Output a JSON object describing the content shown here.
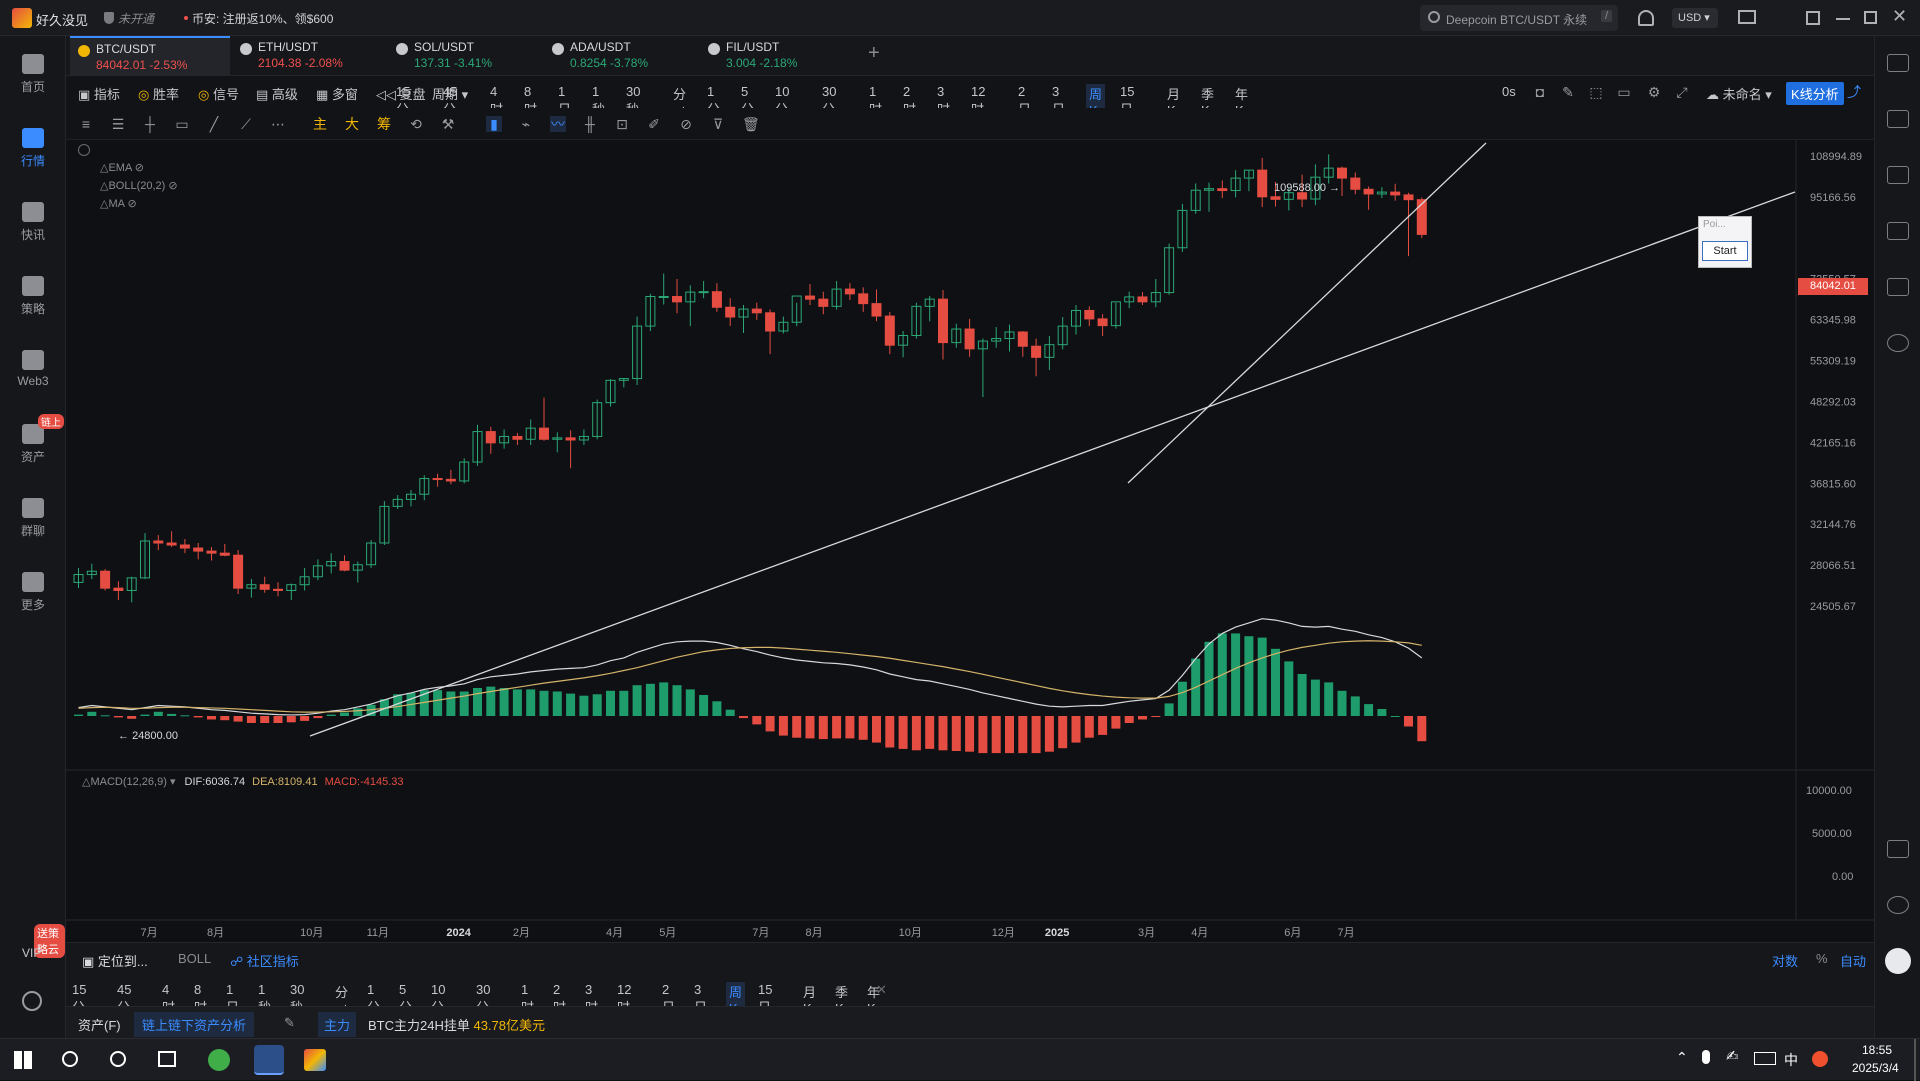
{
  "app": {
    "name": "好久没见",
    "status_badge": "未开通",
    "promo": "币安: 注册返10%、领$600",
    "search_placeholder": "Deepcoin BTC/USDT 永续",
    "search_shortcut": "/",
    "currency": "USD"
  },
  "leftnav": [
    {
      "label": "首页"
    },
    {
      "label": "行情"
    },
    {
      "label": "快讯"
    },
    {
      "label": "策略"
    },
    {
      "label": "Web3"
    },
    {
      "label": "资产",
      "badge": "链上"
    },
    {
      "label": "群聊"
    },
    {
      "label": "更多"
    }
  ],
  "leftnav_bottom": {
    "vip": "VIP",
    "vip_badge": "送策略云"
  },
  "tabs": [
    {
      "symbol": "BTC/USDT",
      "price": "84042.01",
      "change": "-2.53%",
      "color": "#f2b705"
    },
    {
      "symbol": "ETH/USDT",
      "price": "2104.38",
      "change": "-2.08%",
      "color": "#c8c9cc"
    },
    {
      "symbol": "SOL/USDT",
      "price": "137.31",
      "change": "-3.41%",
      "color": "#c8c9cc"
    },
    {
      "symbol": "ADA/USDT",
      "price": "0.8254",
      "change": "-3.78%",
      "color": "#c8c9cc"
    },
    {
      "symbol": "FIL/USDT",
      "price": "3.004",
      "change": "-2.18%",
      "color": "#c8c9cc"
    }
  ],
  "toolbar": {
    "indicators": "指标",
    "winrate": "胜率",
    "signal": "信号",
    "advanced": "高级",
    "multiwin": "多窗",
    "replay": "复盘",
    "period": "周期",
    "timeframes": [
      "15分",
      "45分",
      "4时",
      "8时",
      "1日",
      "1秒",
      "30秒",
      "分时",
      "1分",
      "5分",
      "10分",
      "30分",
      "1时",
      "2时",
      "3时",
      "12时",
      "2日",
      "3日",
      "周K",
      "15日",
      "月K",
      "季K",
      "年K"
    ],
    "selected_tf": "周K",
    "right_label_0s": "0s",
    "unnamed": "未命名",
    "kline_analysis": "K线分析"
  },
  "drawtools": {
    "main": "主",
    "big": "大",
    "chip": "筹"
  },
  "chart_overlays": {
    "legend": [
      {
        "name": "EMA"
      },
      {
        "name": "BOLL(20,2)"
      },
      {
        "name": "MA"
      }
    ],
    "high_label": "109588.00",
    "low_label": "24800.00",
    "current_price": "84042.01",
    "popup_title": "Poi...",
    "popup_button": "Start"
  },
  "macd": {
    "label": "MACD(12,26,9)",
    "dif": "DIF:6036.74",
    "dea": "DEA:8109.41",
    "macd": "MACD:-4145.33",
    "yticks": [
      "10000.00",
      "5000.00",
      "0.00"
    ]
  },
  "chart_data": {
    "type": "candlestick",
    "yaxis_ticks": [
      "108994.89",
      "95166.56",
      "72550.57",
      "63345.98",
      "55309.19",
      "48292.03",
      "42165.16",
      "36815.60",
      "32144.76",
      "28066.51",
      "24505.67"
    ],
    "xaxis_ticks": [
      "7月",
      "8月",
      "10月",
      "11月",
      "2024",
      "2月",
      "4月",
      "5月",
      "7月",
      "8月",
      "10月",
      "12月",
      "2025",
      "3月",
      "4月",
      "6月",
      "7月"
    ],
    "ohlc": [
      [
        26500,
        27800,
        26000,
        27200
      ],
      [
        27200,
        28200,
        26800,
        27500
      ],
      [
        27500,
        27700,
        25800,
        26000
      ],
      [
        26000,
        26600,
        25000,
        25800
      ],
      [
        25800,
        27000,
        24800,
        26900
      ],
      [
        26900,
        31200,
        26800,
        30400
      ],
      [
        30400,
        31000,
        29500,
        30200
      ],
      [
        30200,
        31400,
        29800,
        30000
      ],
      [
        30000,
        30600,
        29200,
        29700
      ],
      [
        29700,
        30200,
        28600,
        29400
      ],
      [
        29400,
        29800,
        28500,
        29200
      ],
      [
        29200,
        30100,
        28900,
        29000
      ],
      [
        29000,
        29500,
        25500,
        26000
      ],
      [
        26000,
        26800,
        25200,
        26300
      ],
      [
        26300,
        27000,
        25600,
        25900
      ],
      [
        25900,
        26500,
        25300,
        25800
      ],
      [
        25800,
        26400,
        25000,
        26300
      ],
      [
        26300,
        27800,
        25800,
        27000
      ],
      [
        27000,
        28600,
        26700,
        28000
      ],
      [
        28000,
        29200,
        27300,
        28400
      ],
      [
        28400,
        29000,
        27500,
        27600
      ],
      [
        27600,
        28400,
        26500,
        28100
      ],
      [
        28100,
        30500,
        27800,
        30200
      ],
      [
        30200,
        34700,
        30000,
        34100
      ],
      [
        34100,
        35400,
        33800,
        34900
      ],
      [
        34900,
        36000,
        34100,
        35500
      ],
      [
        35500,
        37800,
        34800,
        37400
      ],
      [
        37400,
        38000,
        36400,
        37300
      ],
      [
        37300,
        38500,
        36700,
        37100
      ],
      [
        37100,
        40000,
        36800,
        39500
      ],
      [
        39500,
        44700,
        39000,
        43700
      ],
      [
        43700,
        44400,
        40600,
        42100
      ],
      [
        42100,
        44000,
        41300,
        43000
      ],
      [
        43000,
        43500,
        41800,
        42600
      ],
      [
        42600,
        45500,
        41800,
        44200
      ],
      [
        44200,
        48900,
        42400,
        42600
      ],
      [
        42600,
        43600,
        40800,
        42800
      ],
      [
        42800,
        43900,
        38700,
        42500
      ],
      [
        42500,
        44000,
        41800,
        43000
      ],
      [
        43000,
        48600,
        42600,
        48100
      ],
      [
        48100,
        52000,
        47500,
        51800
      ],
      [
        51800,
        52200,
        50600,
        52100
      ],
      [
        52100,
        64000,
        51000,
        62000
      ],
      [
        62000,
        69000,
        61000,
        68400
      ],
      [
        68400,
        73800,
        66600,
        68400
      ],
      [
        68400,
        72500,
        64700,
        67200
      ],
      [
        67200,
        71000,
        62000,
        69400
      ],
      [
        69400,
        72000,
        68000,
        69500
      ],
      [
        69500,
        71500,
        65000,
        66000
      ],
      [
        66000,
        68000,
        62000,
        63900
      ],
      [
        63900,
        66500,
        60600,
        65600
      ],
      [
        65600,
        67000,
        63300,
        64800
      ],
      [
        64800,
        65500,
        56500,
        61000
      ],
      [
        61000,
        64000,
        60500,
        62800
      ],
      [
        62800,
        67000,
        62000,
        68500
      ],
      [
        68500,
        71300,
        66500,
        67800
      ],
      [
        67800,
        69500,
        64500,
        66200
      ],
      [
        66200,
        72000,
        65500,
        70100
      ],
      [
        70100,
        71500,
        67600,
        69000
      ],
      [
        69000,
        70500,
        65000,
        66800
      ],
      [
        66800,
        70000,
        63000,
        64100
      ],
      [
        64100,
        65000,
        56500,
        58200
      ],
      [
        58200,
        61000,
        55900,
        60100
      ],
      [
        60100,
        67000,
        59500,
        66200
      ],
      [
        66200,
        68500,
        63000,
        67800
      ],
      [
        67800,
        69900,
        55500,
        58700
      ],
      [
        58700,
        62500,
        57700,
        61400
      ],
      [
        61400,
        63500,
        56000,
        57500
      ],
      [
        57500,
        59500,
        49000,
        59000
      ],
      [
        59000,
        61800,
        57700,
        59500
      ],
      [
        59500,
        62300,
        57000,
        60800
      ],
      [
        60800,
        61000,
        56000,
        58000
      ],
      [
        58000,
        59500,
        52500,
        55900
      ],
      [
        55900,
        60000,
        53600,
        58300
      ],
      [
        58300,
        63900,
        57400,
        62000
      ],
      [
        62000,
        66500,
        60300,
        65300
      ],
      [
        65300,
        66200,
        62000,
        63500
      ],
      [
        63500,
        64500,
        60000,
        62100
      ],
      [
        62100,
        67000,
        61500,
        67200
      ],
      [
        67200,
        69500,
        65800,
        68300
      ],
      [
        68300,
        69400,
        66500,
        67200
      ],
      [
        67200,
        72500,
        66000,
        69300
      ],
      [
        69300,
        81500,
        68800,
        80400
      ],
      [
        80400,
        93000,
        79300,
        91000
      ],
      [
        91000,
        99500,
        90000,
        97300
      ],
      [
        97300,
        99800,
        90600,
        97800
      ],
      [
        97800,
        100500,
        94800,
        97200
      ],
      [
        97200,
        104000,
        95000,
        101300
      ],
      [
        101300,
        104000,
        97000,
        104000
      ],
      [
        104000,
        108300,
        92000,
        95200
      ],
      [
        95200,
        100000,
        92200,
        94400
      ],
      [
        94400,
        98200,
        91000,
        96500
      ],
      [
        96500,
        102500,
        92000,
        94500
      ],
      [
        94500,
        106000,
        92600,
        101600
      ],
      [
        101600,
        109588,
        99500,
        104700
      ],
      [
        104700,
        105200,
        95500,
        101300
      ],
      [
        101300,
        103200,
        96000,
        97600
      ],
      [
        97600,
        98500,
        91200,
        96100
      ],
      [
        96100,
        98300,
        94800,
        96700
      ],
      [
        96700,
        99400,
        94000,
        95800
      ],
      [
        95800,
        96500,
        78200,
        94300
      ],
      [
        94300,
        95000,
        83000,
        84042
      ]
    ],
    "macd_dif": [
      1200,
      1500,
      1300,
      1100,
      900,
      1200,
      1500,
      1400,
      1300,
      1100,
      900,
      800,
      600,
      400,
      300,
      200,
      150,
      200,
      400,
      700,
      900,
      1300,
      1700,
      2300,
      2900,
      3300,
      3800,
      4100,
      4300,
      4600,
      5200,
      5600,
      5800,
      6000,
      6300,
      6500,
      6700,
      6800,
      6900,
      7300,
      7900,
      8300,
      9100,
      9700,
      10300,
      10600,
      10700,
      10700,
      10500,
      10100,
      9600,
      9200,
      8700,
      8300,
      8000,
      7800,
      7600,
      7500,
      7300,
      7000,
      6600,
      6000,
      5600,
      5200,
      5000,
      4600,
      4200,
      3800,
      3300,
      2900,
      2500,
      2100,
      1700,
      1400,
      1300,
      1400,
      1500,
      1500,
      1800,
      2100,
      2300,
      2500,
      3700,
      5800,
      8200,
      10300,
      11800,
      12700,
      13300,
      13900,
      13700,
      13300,
      12800,
      12700,
      12800,
      12400,
      12100,
      11600,
      11200,
      10600,
      9700,
      8300
    ],
    "macd_dea": [
      1100,
      1200,
      1250,
      1200,
      1100,
      1100,
      1200,
      1250,
      1250,
      1200,
      1150,
      1100,
      1000,
      900,
      800,
      700,
      600,
      550,
      550,
      600,
      650,
      750,
      900,
      1100,
      1350,
      1650,
      1950,
      2250,
      2550,
      2850,
      3200,
      3500,
      3800,
      4100,
      4400,
      4700,
      4950,
      5200,
      5450,
      5750,
      6100,
      6500,
      6900,
      7400,
      7900,
      8400,
      8800,
      9200,
      9450,
      9650,
      9750,
      9800,
      9800,
      9700,
      9550,
      9400,
      9250,
      9100,
      8900,
      8700,
      8500,
      8250,
      7950,
      7650,
      7350,
      7050,
      6700,
      6350,
      5950,
      5550,
      5150,
      4750,
      4350,
      3950,
      3600,
      3300,
      3050,
      2850,
      2700,
      2600,
      2550,
      2550,
      2800,
      3350,
      4100,
      5000,
      5900,
      6800,
      7600,
      8300,
      8900,
      9400,
      9800,
      10100,
      10400,
      10600,
      10700,
      10750,
      10700,
      10600,
      10450,
      10100
    ]
  }
}
